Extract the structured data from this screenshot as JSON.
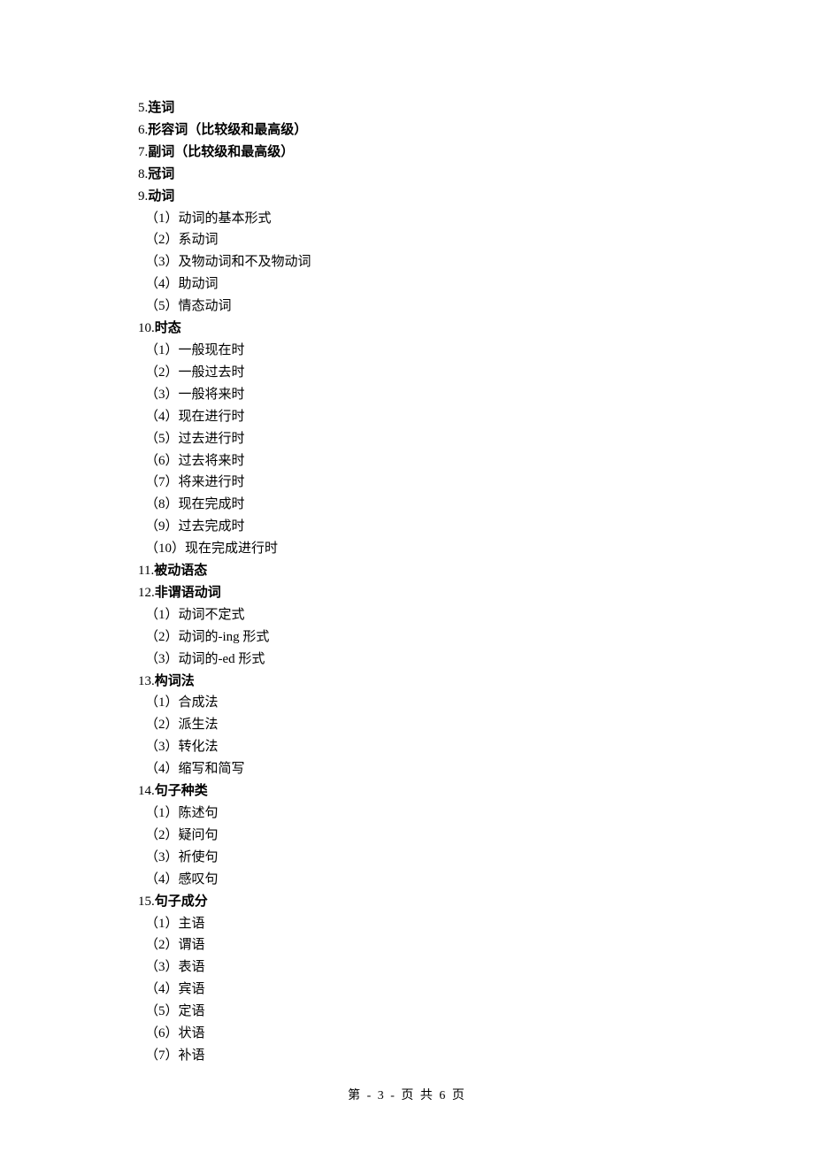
{
  "sections": [
    {
      "num": "5.",
      "title": "连词",
      "subs": []
    },
    {
      "num": "6.",
      "title": "形容词（比较级和最高级）",
      "subs": []
    },
    {
      "num": "7.",
      "title": "副词（比较级和最高级）",
      "subs": []
    },
    {
      "num": "8.",
      "title": "冠词",
      "subs": []
    },
    {
      "num": "9.",
      "title": "动词",
      "subs": [
        "（1）动词的基本形式",
        "（2）系动词",
        "（3）及物动词和不及物动词",
        "（4）助动词",
        "（5）情态动词"
      ]
    },
    {
      "num": "10.",
      "title": "时态",
      "subs": [
        "（1）一般现在时",
        "（2）一般过去时",
        "（3）一般将来时",
        "（4）现在进行时",
        "（5）过去进行时",
        "（6）过去将来时",
        "（7）将来进行时",
        "（8）现在完成时",
        "（9）过去完成时",
        "（10）现在完成进行时"
      ]
    },
    {
      "num": "11.",
      "title": "被动语态",
      "subs": []
    },
    {
      "num": "12.",
      "title": "非谓语动词",
      "subs": [
        "（1）动词不定式",
        "（2）动词的-ing 形式",
        "（3）动词的-ed 形式"
      ]
    },
    {
      "num": "13.",
      "title": "构词法",
      "subs": [
        "（1）合成法",
        "（2）派生法",
        "（3）转化法",
        "（4）缩写和简写"
      ]
    },
    {
      "num": "14.",
      "title": "句子种类",
      "subs": [
        "（1）陈述句",
        "（2）疑问句",
        "（3）祈使句",
        "（4）感叹句"
      ]
    },
    {
      "num": "15.",
      "title": "句子成分",
      "subs": [
        "（1）主语",
        "（2）谓语",
        "（3）表语",
        "（4）宾语",
        "（5）定语",
        "（6）状语",
        "（7）补语"
      ]
    }
  ],
  "footer": "第 - 3 - 页 共 6 页"
}
